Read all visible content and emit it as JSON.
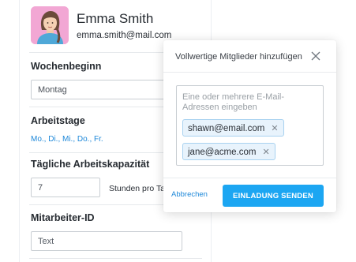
{
  "profile": {
    "name": "Emma Smith",
    "email": "emma.smith@mail.com",
    "avatar_icon": "avatar-woman-illustration",
    "avatar_bg": "#f2a7d4"
  },
  "settings": {
    "week_start": {
      "label": "Wochenbeginn",
      "value": "Montag"
    },
    "workdays": {
      "label": "Arbeitstage",
      "value": "Mo., Di., Mi., Do., Fr."
    },
    "capacity": {
      "label": "Tägliche Arbeitskapazität",
      "value": "7",
      "unit": "Stunden pro Tag"
    },
    "employee_id": {
      "label": "Mitarbeiter-ID",
      "placeholder": "Text"
    }
  },
  "modal": {
    "title": "Vollwertige Mitglieder hinzufügen",
    "close_icon": "close-icon",
    "email_placeholder": "Eine oder mehrere E-Mail-Adressen eingeben",
    "chips": [
      {
        "email": "shawn@email.com",
        "remove_icon": "close-icon"
      },
      {
        "email": "jane@acme.com",
        "remove_icon": "close-icon"
      }
    ],
    "cancel_label": "Abbrechen",
    "send_label": "EINLADUNG SENDEN",
    "accent_color": "#1ca6f2",
    "link_color": "#1e88d9"
  }
}
